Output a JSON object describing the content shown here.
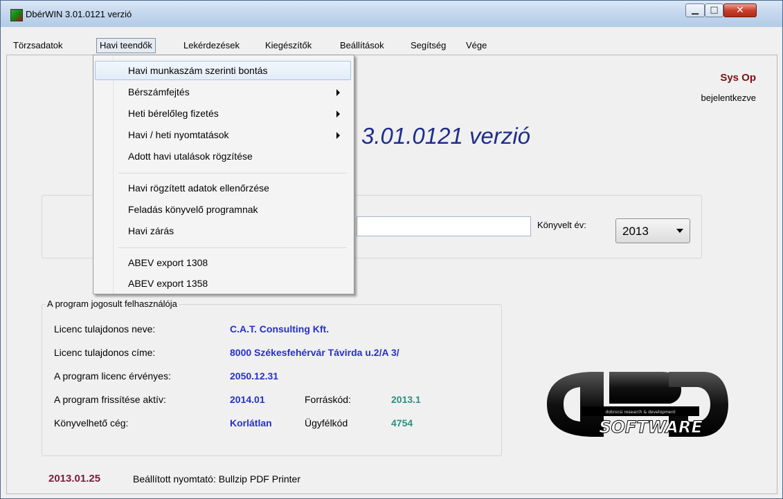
{
  "window": {
    "title": "DbérWIN 3.01.0121 verzió"
  },
  "menu": [
    {
      "label": "Törzsadatok"
    },
    {
      "label": "Havi teendők"
    },
    {
      "label": "Lekérdezések"
    },
    {
      "label": "Kiegészítők"
    },
    {
      "label": "Beállítások"
    },
    {
      "label": "Segítség"
    },
    {
      "label": "Vége"
    }
  ],
  "dropdown": {
    "items": [
      {
        "label": "Havi munkaszám szerinti bontás",
        "submenu": false,
        "highlighted": true
      },
      {
        "label": "Bérszámfejtés",
        "submenu": true
      },
      {
        "label": "Heti bérelőleg fizetés",
        "submenu": true
      },
      {
        "label": "Havi / heti nyomtatások",
        "submenu": true
      },
      {
        "label": "Adott havi utalások rögzítése",
        "submenu": false
      },
      {
        "label": "Havi rögzített adatok ellenőrzése",
        "submenu": false
      },
      {
        "label": "Feladás könyvelő programnak",
        "submenu": false
      },
      {
        "label": "Havi zárás",
        "submenu": false
      },
      {
        "label": "ABEV export 1308",
        "submenu": false
      },
      {
        "label": "ABEV export 1358",
        "submenu": false
      }
    ]
  },
  "user": {
    "name": "Sys Op",
    "status": "bejelentkezve"
  },
  "version_title": "3.01.0121 verzió",
  "year_select": {
    "label": "Könyvelt év:",
    "value": "2013"
  },
  "license": {
    "legend": "A program jogosult felhasználója",
    "owner_label": "Licenc tulajdonos neve:",
    "owner_value": "C.A.T. Consulting Kft.",
    "address_label": "Licenc tulajdonos címe:",
    "address_value": "8000 Székesfehérvár Távirda u.2/A 3/",
    "valid_label": "A program licenc érvényes:",
    "valid_value": "2050.12.31",
    "update_label": "A program frissítése aktív:",
    "update_value": "2014.01",
    "source_label": "Forráskód:",
    "source_value": "2013.1",
    "company_label": "Könyvelhető cég:",
    "company_value": "Korlátlan",
    "client_label": "Ügyfélkód",
    "client_value": "4754"
  },
  "footer": {
    "date": "2013.01.25",
    "printer": "Beállított nyomtató: Bullzip PDF Printer"
  },
  "logo": {
    "line1": "dobrocsi research & development",
    "line2": "SOFTWARE"
  },
  "colors": {
    "title_blue": "#1f2c8c",
    "value_blue": "#2530c8",
    "value_teal": "#2a8f7f",
    "user_red": "#7a1212",
    "date_maroon": "#7a1c3a"
  }
}
